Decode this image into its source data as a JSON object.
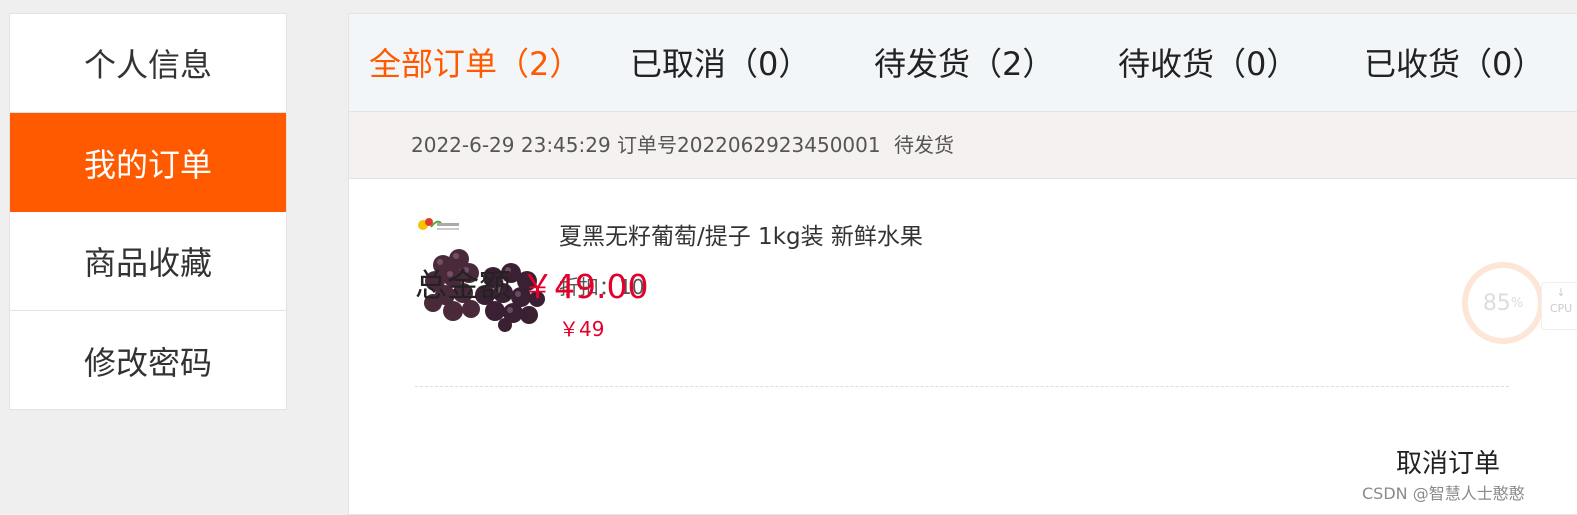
{
  "sidebar": {
    "items": [
      {
        "label": "个人信息",
        "active": false
      },
      {
        "label": "我的订单",
        "active": true
      },
      {
        "label": "商品收藏",
        "active": false
      },
      {
        "label": "修改密码",
        "active": false
      }
    ]
  },
  "tabs": [
    {
      "label": "全部订单（2）",
      "active": true
    },
    {
      "label": "已取消（0）",
      "active": false
    },
    {
      "label": "待发货（2）",
      "active": false
    },
    {
      "label": "待收货（0）",
      "active": false
    },
    {
      "label": "已收货（0）",
      "active": false
    }
  ],
  "order": {
    "datetime": "2022-6-29 23:45:29",
    "order_no": "订单号2022062923450001",
    "status": "待发货",
    "product": {
      "title": "夏黑无籽葡萄/提子 1kg装 新鲜水果",
      "discount": "折扣：10",
      "price": "￥49"
    },
    "total_label": "总金额",
    "total_amount": "￥49.00",
    "cancel_label": "取消订单"
  },
  "cpu_widget": {
    "value": "85",
    "unit": "%",
    "label": "CPU"
  },
  "watermark": "CSDN @智慧人士憨憨",
  "colors": {
    "accent": "#ff5a00",
    "price": "#e4002b"
  }
}
